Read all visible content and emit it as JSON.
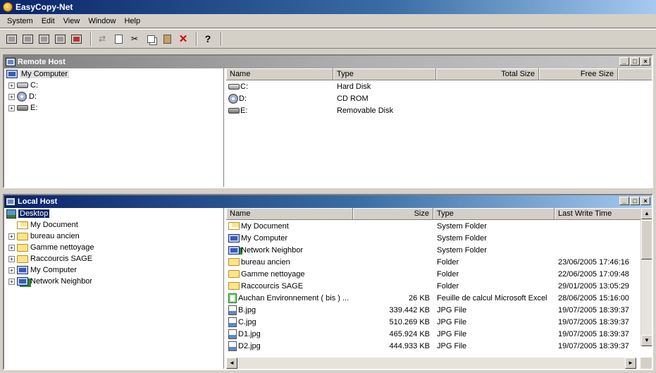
{
  "app": {
    "title": "EasyCopy-Net"
  },
  "menu": [
    "System",
    "Edit",
    "View",
    "Window",
    "Help"
  ],
  "toolbar": {
    "buttons": [
      "connect-icon",
      "host-icon",
      "computer-icon",
      "network-icon",
      "disconnect-icon",
      "transfer-icon",
      "properties-icon",
      "cut-icon",
      "copy-icon",
      "paste-icon",
      "delete-icon",
      "help-icon"
    ],
    "help_glyph": "?",
    "cut_glyph": "✂",
    "delete_glyph": "✕"
  },
  "remote": {
    "title": "Remote Host",
    "tree": {
      "root": "My Computer",
      "items": [
        {
          "label": "C:",
          "icon": "hard-drive-icon"
        },
        {
          "label": "D:",
          "icon": "cd-drive-icon"
        },
        {
          "label": "E:",
          "icon": "removable-drive-icon"
        }
      ]
    },
    "columns": [
      "Name",
      "Type",
      "Total Size",
      "Free Size"
    ],
    "rows": [
      {
        "name": "C:",
        "type": "Hard Disk",
        "icon": "hard-drive-icon"
      },
      {
        "name": "D:",
        "type": "CD ROM",
        "icon": "cd-drive-icon"
      },
      {
        "name": "E:",
        "type": "Removable Disk",
        "icon": "removable-drive-icon"
      }
    ]
  },
  "local": {
    "title": "Local Host",
    "tree": {
      "root": "Desktop",
      "items": [
        {
          "label": "My Document",
          "icon": "my-documents-icon",
          "expandable": false
        },
        {
          "label": "bureau ancien",
          "icon": "folder-icon",
          "expandable": true
        },
        {
          "label": "Gamme nettoyage",
          "icon": "folder-icon",
          "expandable": true
        },
        {
          "label": "Raccourcis SAGE",
          "icon": "folder-icon",
          "expandable": true
        },
        {
          "label": "My Computer",
          "icon": "computer-icon",
          "expandable": true
        },
        {
          "label": "Network Neighbor",
          "icon": "network-icon",
          "expandable": true
        }
      ]
    },
    "columns": [
      "Name",
      "Size",
      "Type",
      "Last Write Time"
    ],
    "rows": [
      {
        "name": "My Document",
        "size": "",
        "type": "System Folder",
        "time": "",
        "icon": "my-documents-icon"
      },
      {
        "name": "My Computer",
        "size": "",
        "type": "System Folder",
        "time": "",
        "icon": "computer-icon"
      },
      {
        "name": "Network Neighbor",
        "size": "",
        "type": "System Folder",
        "time": "",
        "icon": "network-icon"
      },
      {
        "name": "bureau ancien",
        "size": "",
        "type": "Folder",
        "time": "23/06/2005 17:46:16",
        "icon": "folder-icon"
      },
      {
        "name": "Gamme nettoyage",
        "size": "",
        "type": "Folder",
        "time": "22/06/2005 17:09:48",
        "icon": "folder-icon"
      },
      {
        "name": "Raccourcis SAGE",
        "size": "",
        "type": "Folder",
        "time": "29/01/2005 13:05:29",
        "icon": "folder-icon"
      },
      {
        "name": "Auchan Environnement ( bis ) ...",
        "size": "26 KB",
        "type": "Feuille de calcul Microsoft Excel",
        "time": "28/06/2005 15:16:00",
        "icon": "excel-file-icon"
      },
      {
        "name": "B.jpg",
        "size": "339.442 KB",
        "type": "JPG File",
        "time": "19/07/2005 18:39:37",
        "icon": "jpg-file-icon"
      },
      {
        "name": "C.jpg",
        "size": "510.269 KB",
        "type": "JPG File",
        "time": "19/07/2005 18:39:37",
        "icon": "jpg-file-icon"
      },
      {
        "name": "D1.jpg",
        "size": "465.924 KB",
        "type": "JPG File",
        "time": "19/07/2005 18:39:37",
        "icon": "jpg-file-icon"
      },
      {
        "name": "D2.jpg",
        "size": "444.933 KB",
        "type": "JPG File",
        "time": "19/07/2005 18:39:37",
        "icon": "jpg-file-icon"
      }
    ]
  },
  "window_buttons": {
    "minimize": "_",
    "restore": "□",
    "close": "×"
  },
  "scroll": {
    "up": "▲",
    "down": "▼",
    "left": "◄",
    "right": "►"
  }
}
